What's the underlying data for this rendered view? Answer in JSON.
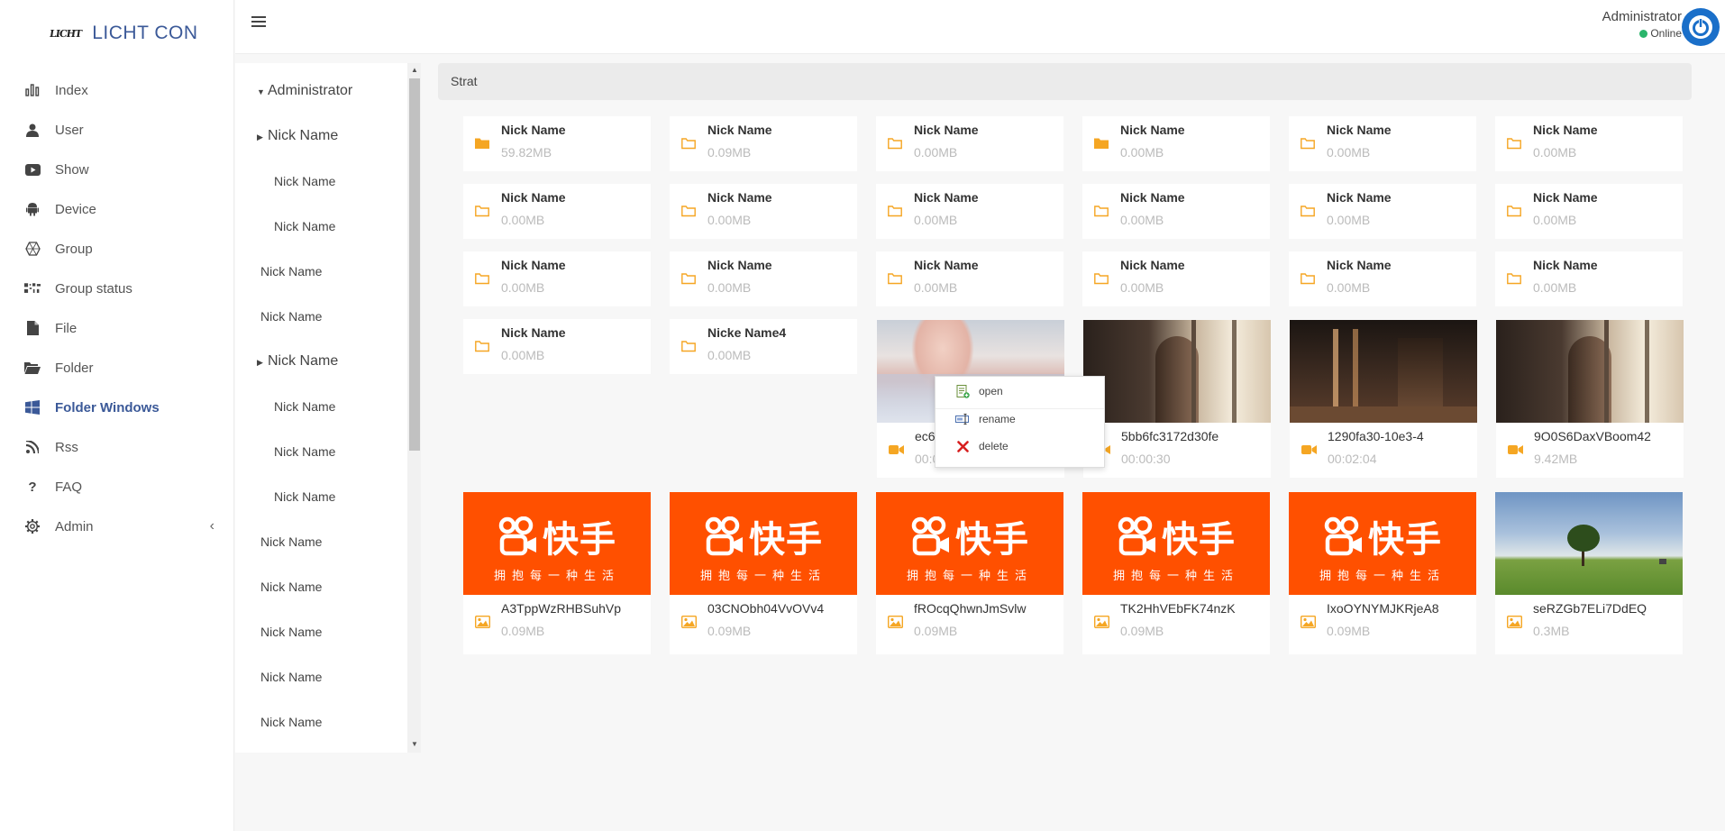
{
  "brand": {
    "logo_text": "LICHT",
    "name": "LICHT CON"
  },
  "nav": [
    {
      "label": "Index",
      "icon": "bar-chart-icon"
    },
    {
      "label": "User",
      "icon": "user-icon"
    },
    {
      "label": "Show",
      "icon": "play-icon"
    },
    {
      "label": "Device",
      "icon": "android-icon"
    },
    {
      "label": "Group",
      "icon": "hexagon-icon"
    },
    {
      "label": "Group status",
      "icon": "qr-icon"
    },
    {
      "label": "File",
      "icon": "file-icon"
    },
    {
      "label": "Folder",
      "icon": "folder-open-icon"
    },
    {
      "label": "Folder Windows",
      "icon": "windows-icon",
      "active": true
    },
    {
      "label": "Rss",
      "icon": "rss-icon"
    },
    {
      "label": "FAQ",
      "icon": "question-icon"
    },
    {
      "label": "Admin",
      "icon": "gear-icon",
      "has_arrow": true
    }
  ],
  "user": {
    "name": "Administrator",
    "status": "Online",
    "status_color": "#2ab56b"
  },
  "tree": [
    {
      "label": "Administrator",
      "caret": "down"
    },
    {
      "label": "Nick Name",
      "caret": "right"
    },
    {
      "label": "Nick Name"
    },
    {
      "label": "Nick Name"
    },
    {
      "label": "Nick Name"
    },
    {
      "label": "Nick Name"
    },
    {
      "label": "Nick Name",
      "caret": "right"
    },
    {
      "label": "Nick Name"
    },
    {
      "label": "Nick Name"
    },
    {
      "label": "Nick Name"
    },
    {
      "label": "Nick Name"
    },
    {
      "label": "Nick Name"
    },
    {
      "label": "Nick Name"
    },
    {
      "label": "Nick Name"
    },
    {
      "label": "Nick Name"
    }
  ],
  "breadcrumb": "Strat",
  "folders": [
    {
      "name": "Nick Name",
      "size": "59.82MB",
      "filled": true
    },
    {
      "name": "Nick Name",
      "size": "0.09MB"
    },
    {
      "name": "Nick Name",
      "size": "0.00MB"
    },
    {
      "name": "Nick Name",
      "size": "0.00MB",
      "filled": true
    },
    {
      "name": "Nick Name",
      "size": "0.00MB"
    },
    {
      "name": "Nick Name",
      "size": "0.00MB"
    },
    {
      "name": "Nick Name",
      "size": "0.00MB"
    },
    {
      "name": "Nick Name",
      "size": "0.00MB"
    },
    {
      "name": "Nick Name",
      "size": "0.00MB"
    },
    {
      "name": "Nick Name",
      "size": "0.00MB"
    },
    {
      "name": "Nick Name",
      "size": "0.00MB"
    },
    {
      "name": "Nick Name",
      "size": "0.00MB"
    },
    {
      "name": "Nick Name",
      "size": "0.00MB"
    },
    {
      "name": "Nick Name",
      "size": "0.00MB"
    },
    {
      "name": "Nick Name",
      "size": "0.00MB"
    },
    {
      "name": "Nick Name",
      "size": "0.00MB"
    },
    {
      "name": "Nick Name",
      "size": "0.00MB"
    },
    {
      "name": "Nick Name",
      "size": "0.00MB"
    },
    {
      "name": "Nick Name",
      "size": "0.00MB"
    },
    {
      "name": "Nicke Name4",
      "size": "0.00MB"
    }
  ],
  "videos": [
    {
      "name": "ec6",
      "size": "00:0",
      "thumb": "girl-pink"
    },
    {
      "name": "5bb6fc3172d30fe",
      "size": "00:00:30",
      "thumb": "girl-window"
    },
    {
      "name": "1290fa30-10e3-4",
      "size": "00:02:04",
      "thumb": "room-dark"
    },
    {
      "name": "9O0S6DaxVBoom42",
      "size": "9.42MB",
      "thumb": "girl-window"
    }
  ],
  "images": [
    {
      "name": "A3TppWzRHBSuhVp",
      "size": "0.09MB",
      "thumb": "kuaishou"
    },
    {
      "name": "03CNObh04VvOVv4",
      "size": "0.09MB",
      "thumb": "kuaishou"
    },
    {
      "name": "fROcqQhwnJmSvlw",
      "size": "0.09MB",
      "thumb": "kuaishou"
    },
    {
      "name": "TK2HhVEbFK74nzK",
      "size": "0.09MB",
      "thumb": "kuaishou"
    },
    {
      "name": "IxoOYNYMJKRjeA8",
      "size": "0.09MB",
      "thumb": "kuaishou"
    },
    {
      "name": "seRZGb7ELi7DdEQ",
      "size": "0.3MB",
      "thumb": "landscape"
    }
  ],
  "kuaishou": {
    "title": "快手",
    "subtitle": "拥抱每一种生活"
  },
  "context_menu": [
    {
      "label": "open",
      "icon": "open-icon"
    },
    {
      "label": "rename",
      "icon": "rename-icon"
    },
    {
      "label": "delete",
      "icon": "delete-icon"
    }
  ],
  "colors": {
    "accent": "#3b5998",
    "folder": "#f5a623",
    "kuaishou": "#ff5000",
    "avatar": "#1a6fc9"
  }
}
